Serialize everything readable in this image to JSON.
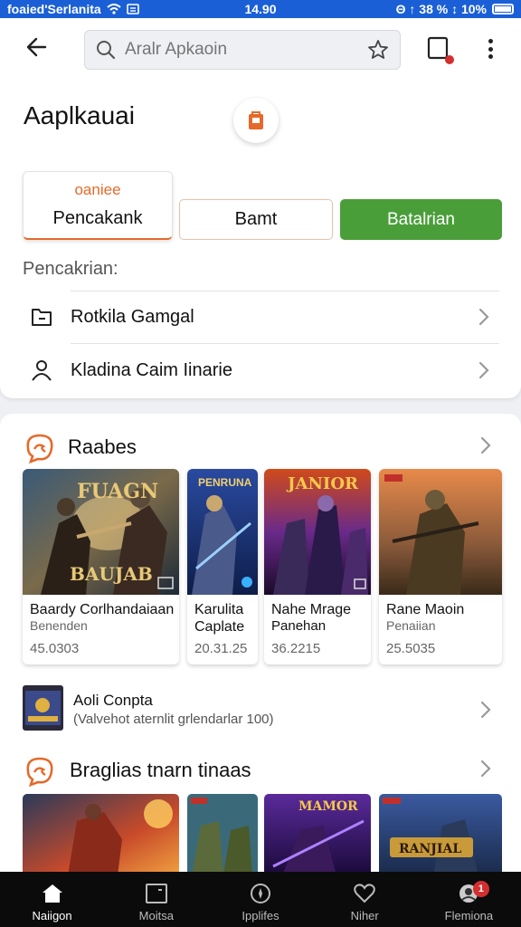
{
  "status": {
    "carrier": "foaied'Serlanita",
    "time": "14.90",
    "indicators": "Θ ↑ 38 % ↕ 10%"
  },
  "search": {
    "placeholder": "Aralr Apkaoin"
  },
  "page": {
    "title": "Aaplkauai"
  },
  "tabs": [
    {
      "top_label": "oaniee",
      "label": "Pencakank"
    },
    {
      "label": "Bamt"
    },
    {
      "label": "Batalrian"
    }
  ],
  "section_label": "Pencakrian:",
  "list": [
    {
      "label": "Rotkila Gamgal",
      "icon": "folder-icon"
    },
    {
      "label": "Kladina Caim Iinarie",
      "icon": "person-icon"
    }
  ],
  "section1": {
    "title": "Raabes",
    "cards": [
      {
        "art_text": "FUAGN",
        "art_text2": "BAUJAB",
        "title": "Baardy Corlhandaiaan",
        "subtitle": "Benenden",
        "meta": "45.0303"
      },
      {
        "art_text": "PENRUNA",
        "title": "Karulita",
        "subtitle": "Caplate",
        "meta": "20.31.25"
      },
      {
        "art_text": "JANIOR",
        "title": "Nahe Mrage",
        "subtitle": "Panehan",
        "meta": "36.2215"
      },
      {
        "art_text": "",
        "title": "Rane Maoin",
        "subtitle": "Penaiian",
        "meta": "25.5035"
      }
    ]
  },
  "app_row": {
    "name": "Aoli Conpta",
    "subtitle": "(Valvehot aternlit grlendarlar 100)"
  },
  "section2": {
    "title": "Braglias tnarn tinaas",
    "art_text": "RANJIAL"
  },
  "nav": [
    {
      "label": "Naiigon",
      "icon": "home-icon"
    },
    {
      "label": "Moitsa",
      "icon": "tablet-icon"
    },
    {
      "label": "Ipplifes",
      "icon": "compass-icon"
    },
    {
      "label": "Niher",
      "icon": "heart-icon"
    },
    {
      "label": "Flemiona",
      "icon": "profile-icon",
      "badge": "1"
    }
  ],
  "colors": {
    "statusbar": "#1a5fd6",
    "accent": "#e56a2a",
    "green": "#4a9e3a",
    "nav_bg": "#0b0b0b"
  }
}
